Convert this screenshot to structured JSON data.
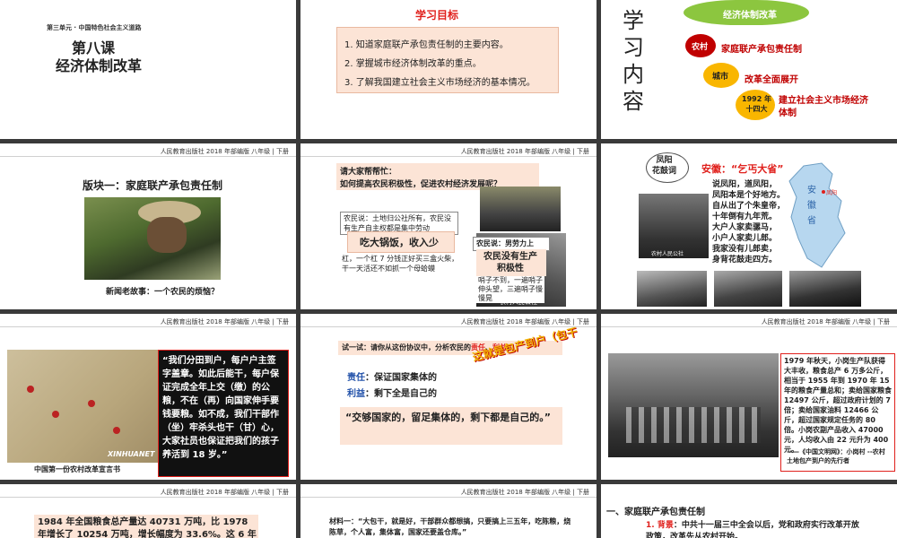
{
  "header_text": "人民教育出版社 2018 年部编版 八年级 | 下册",
  "s1": {
    "unit": "第三单元 · 中国特色社会主义道路",
    "lesson": "第八课",
    "title": "经济体制改革"
  },
  "s2": {
    "heading": "学习目标",
    "goals": [
      "1. 知道家庭联产承包责任制的主要内容。",
      "2. 掌握城市经济体制改革的重点。",
      "3. 了解我国建立社会主义市场经济的基本情况。"
    ]
  },
  "s3": {
    "big": "学\n习\n内\n容",
    "top": "经济体制改革",
    "items": [
      {
        "badge": "农村",
        "text": "家庭联产承包责任制"
      },
      {
        "badge": "城市",
        "text": "改革全面展开"
      },
      {
        "badge": "1992 年\n十四大",
        "text": "建立社会主义市场经济\n体制"
      }
    ]
  },
  "s4": {
    "title": "版块一：家庭联产承包责任制",
    "caption": "新闻老故事：一个农民的烦恼？"
  },
  "s5": {
    "q1": "请大家帮帮忙：",
    "q2": "如何提高农民积极性，促进农村经济发展呢？",
    "box1": "农民说：土地归公社所有，农民没有生产自主权都是集中劳动",
    "label1": "吃大锅饭，收入少",
    "box2": "杠，一个杠 7 分钱正好买三盒火柴，干一天活还不如抓一个母蛤蟆",
    "box3": "农民说：男劳力上",
    "label2": "农民没有生产\n积极性",
    "box4": "哨子不到，一遍哨子伸头望，三遍哨子慢慢晃",
    "photo_caption": "农村人民公社"
  },
  "s6": {
    "tag": "凤阳\n花鼓词",
    "title": "安徽：“乞丐大省”",
    "poem": "说凤阳，道凤阳，\n凤阳本是个好地方。\n自从出了个朱皇帝，\n十年倒有九年荒。\n大户人家卖骡马，\n小户人家卖儿郎。\n我家没有儿郎卖，\n身背花鼓走四方。",
    "map_label": "安\n徽\n省",
    "city": "凤阳",
    "photo_caption": "农村人民公社"
  },
  "s7": {
    "quote": "“我们分田到户，每户户主签字盖章。如此后能干，每户保证完成全年上交（缴）的公粮，不在（再）向国家伸手要钱要粮。如不成，我们干部作（坐）牢杀头也干（甘）心，大家社员也保证把我们的孩子养活到 18 岁。”",
    "watermark": "XINHUANET",
    "caption": "中国第一份农村改革宣言书"
  },
  "s8": {
    "prompt_a": "试一试：请你从这份协议中，分析农民的",
    "prompt_b": "责任",
    "prompt_c": "、",
    "prompt_d": "利益",
    "prompt_e": "。",
    "r_label": "责任",
    "r_text": "：保证国家集体的",
    "b_label": "利益",
    "b_text": "：剩下全是自己的",
    "quote": "“交够国家的，留足集体的，剩下都是自己的。”",
    "art": "这就是包产到户（包干到户）"
  },
  "s9": {
    "text": "1979 年秋天，小岗生产队获得大丰收，粮食总产 6 万多公斤，相当于 1955 年到 1970 年 15 年的粮食产量总和；卖给国家粮食 12497 公斤，超过政府计划的 7 倍；卖给国家油料 12466 公斤，超过国家规定任务的 80 倍。小岗农副产品收入 47000 元，人均收入由 22 元升为 400 元。",
    "source": "——《中国文明网》：小岗村 --农村土地包产到户的先行者"
  },
  "s10": {
    "text": "1984 年全国粮食总产量达 40731 万吨，比 1978 年增长了 10254 万吨，增长幅度为 33.6%。这 6 年全国"
  },
  "s11": {
    "text": "材料一：“大包干，就是好，干部群众都想搞，只要搞上三五年，吃陈粮，烧陈草，个人富，集体富，国家还要盖仓库。”"
  },
  "s12": {
    "heading": "一、家庭联产承包责任制",
    "label": "1. 背景",
    "text": "：中共十一届三中全会以后，党和政府实行改革开放政策，改革先从农村开始。"
  }
}
